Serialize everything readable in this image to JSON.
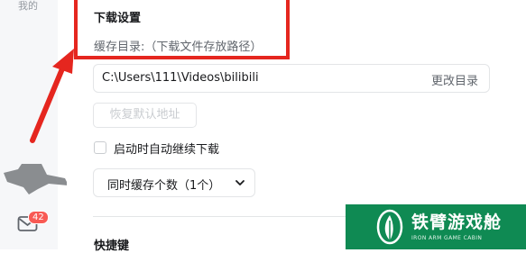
{
  "sidebar": {
    "label": "我的",
    "badge_count": "42"
  },
  "download_settings": {
    "title": "下载设置",
    "cache_label": "缓存目录:（下载文件存放路径）",
    "path_value": "C:\\Users\\111\\Videos\\bilibili",
    "change_dir_label": "更改目录",
    "restore_default_label": "恢复默认地址",
    "auto_resume_label": "启动时自动继续下载",
    "auto_resume_checked": false,
    "concurrent_select_label": "同时缓存个数（1个）"
  },
  "shortcuts": {
    "title": "快捷键"
  },
  "watermark": {
    "name": "铁臂游戏舱",
    "subtitle": "IRON ARM GAME CABIN"
  },
  "colors": {
    "annotation_red": "#e5261f",
    "badge_red": "#f85a54",
    "watermark_green": "#0f8a53"
  }
}
